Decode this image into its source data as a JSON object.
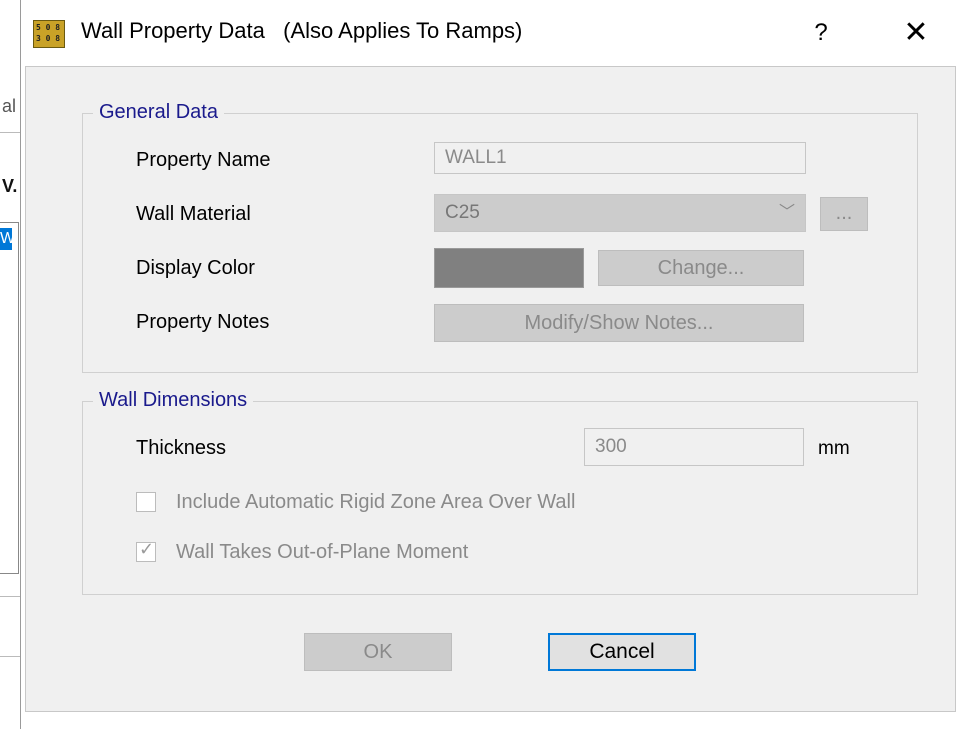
{
  "background": {
    "fragments": [
      "al",
      "V.",
      "W"
    ]
  },
  "window": {
    "title": "Wall Property Data   (Also Applies To Ramps)",
    "help_label": "?",
    "close_label": "✕",
    "icon": "etabs-app-icon"
  },
  "general_data": {
    "group_label": "General Data",
    "property_name_label": "Property Name",
    "property_name_value": "WALL1",
    "wall_material_label": "Wall Material",
    "wall_material_value": "C25",
    "material_browse_label": "...",
    "display_color_label": "Display Color",
    "display_color": "#808080",
    "change_button_label": "Change...",
    "property_notes_label": "Property Notes",
    "notes_button_label": "Modify/Show Notes..."
  },
  "wall_dimensions": {
    "group_label": "Wall Dimensions",
    "thickness_label": "Thickness",
    "thickness_value": "300",
    "thickness_unit": "mm",
    "rigid_zone_label": "Include Automatic Rigid Zone Area Over Wall",
    "rigid_zone_checked": false,
    "out_of_plane_label": "Wall Takes Out-of-Plane Moment",
    "out_of_plane_checked": true
  },
  "buttons": {
    "ok_label": "OK",
    "cancel_label": "Cancel"
  },
  "colors": {
    "group_title": "#1a1a8c",
    "accent_focus": "#0078d7"
  }
}
